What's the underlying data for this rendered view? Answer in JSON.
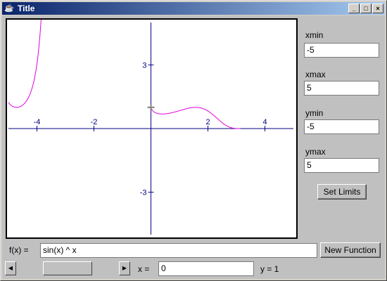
{
  "window": {
    "title": "Title",
    "minimize": "_",
    "maximize": "□",
    "close": "×",
    "icon": "java-cup-icon"
  },
  "limits": {
    "xmin_label": "xmin",
    "xmin_value": "-5",
    "xmax_label": "xmax",
    "xmax_value": "5",
    "ymin_label": "ymin",
    "ymin_value": "-5",
    "ymax_label": "ymax",
    "ymax_value": "5",
    "set_limits_label": "Set Limits"
  },
  "function": {
    "label": "f(x) =",
    "value": "sin(x) ^ x",
    "new_function_label": "New Function"
  },
  "probe": {
    "x_label": "x =",
    "x_value": "0",
    "y_readout": "y = 1",
    "slider_level": 0.5
  },
  "chart_data": {
    "type": "line",
    "function": "sin(x) ^ x",
    "xlim": [
      -5,
      5
    ],
    "ylim": [
      -5,
      5
    ],
    "x_ticks": [
      "-4",
      "-2",
      "2",
      "4"
    ],
    "y_ticks": [
      "3",
      "-3"
    ],
    "marker": {
      "x": 0,
      "y": 1
    },
    "curve_color": "#e000e0",
    "axis_color": "#00007f"
  }
}
